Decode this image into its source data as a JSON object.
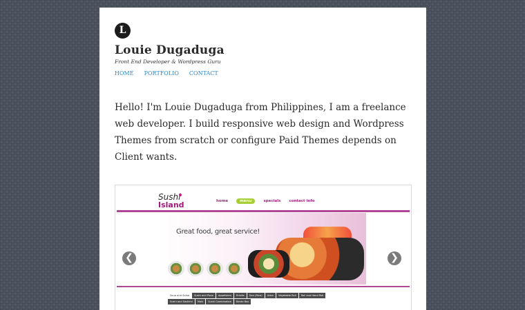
{
  "site": {
    "logo_letter": "L",
    "title": "Louie Dugaduga",
    "tagline": "Front End Developer & Wordpress Guru"
  },
  "nav": {
    "items": [
      {
        "label": "HOME"
      },
      {
        "label": "PORTFOLIO"
      },
      {
        "label": "CONTACT"
      }
    ]
  },
  "intro": {
    "text": "Hello! I'm Louie Dugaduga from Philippines, I am a freelance web developer. I build responsive web design and Wordpress Themes from scratch or configure Paid Themes depends on Client wants."
  },
  "slider": {
    "prev_glyph": "❮",
    "next_glyph": "❯",
    "slide": {
      "logo_line1": "Sushi",
      "logo_line2": "Island",
      "nav": {
        "items": [
          {
            "label": "home"
          },
          {
            "label": "menu"
          },
          {
            "label": "specials"
          },
          {
            "label": "contact info"
          }
        ]
      },
      "hero_text": "Great food, great service!",
      "tabs": [
        {
          "label": "Soup and Salad"
        },
        {
          "label": "Sushi and Pizza"
        },
        {
          "label": "Appetizers"
        },
        {
          "label": "Entrée"
        },
        {
          "label": "Don (Rice)"
        },
        {
          "label": "Udon"
        },
        {
          "label": "Vegetable Roll"
        },
        {
          "label": "Roll and Hand Roll"
        },
        {
          "label": "Sushi and Sashimi"
        },
        {
          "label": "Maki"
        },
        {
          "label": "Sushi Combination"
        },
        {
          "label": "Bento Box"
        }
      ]
    }
  },
  "colors": {
    "link": "#2b87c7",
    "page_bg": "#4a5260",
    "accent_magenta": "#a3247e",
    "accent_green": "#a7cf3a"
  },
  "icons": {
    "logo": "letter-badge",
    "prev": "chevron-left-icon",
    "next": "chevron-right-icon"
  }
}
